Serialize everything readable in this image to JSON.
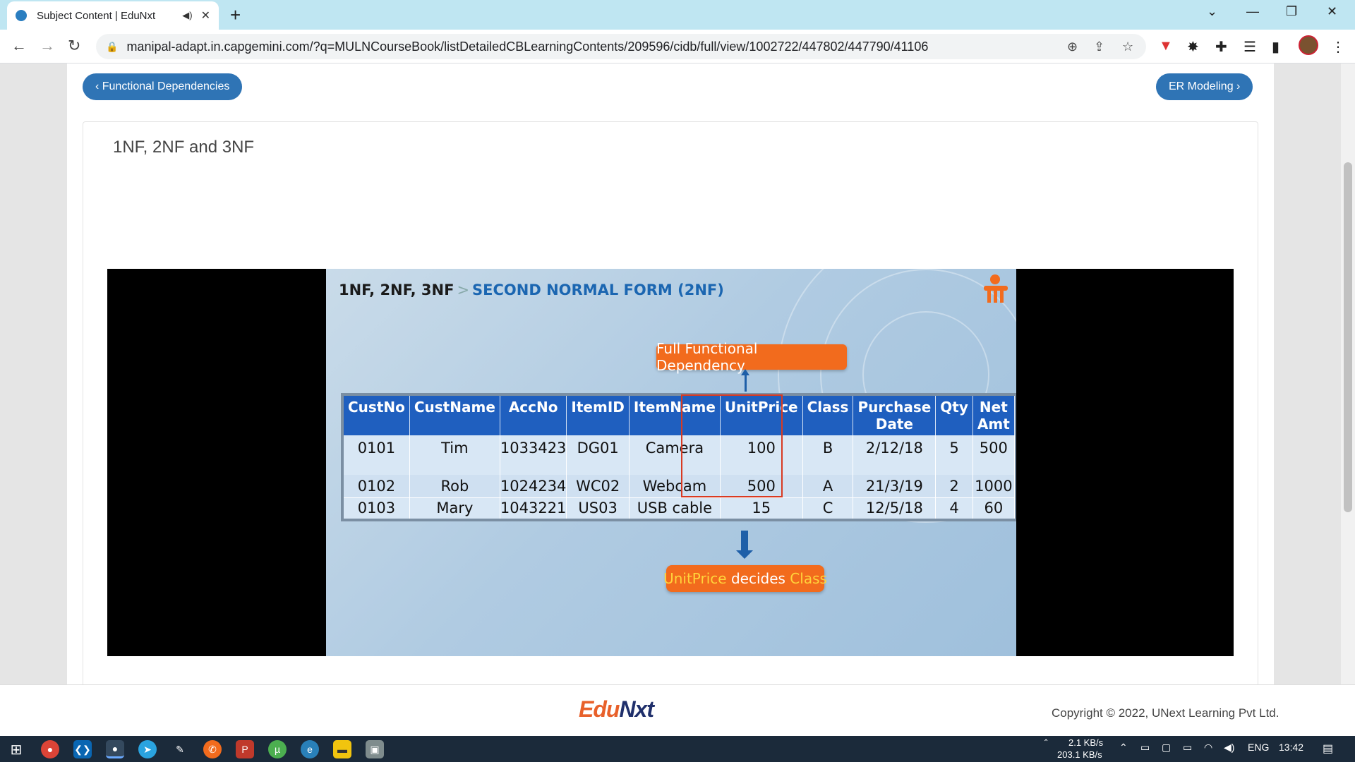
{
  "browser": {
    "tab_title": "Subject Content | EduNxt",
    "tab_audio_icon": "speaker-icon",
    "url": "manipal-adapt.in.capgemini.com/?q=MULNCourseBook/listDetailedCBLearningContents/209596/cidb/full/view/1002722/447802/447790/41106"
  },
  "nav": {
    "prev_label": "‹ Functional Dependencies",
    "next_label": "ER Modeling ›"
  },
  "page": {
    "title": "1NF, 2NF and 3NF"
  },
  "slide": {
    "crumb_parent": "1NF, 2NF, 3NF",
    "crumb_sep": ">",
    "crumb_current": "SECOND NORMAL FORM (2NF)",
    "top_callout": "Full Functional Dependency",
    "bottom_callout_a": "UnitPrice",
    "bottom_callout_b": " decides ",
    "bottom_callout_c": "Class",
    "table": {
      "headers": [
        "CustNo",
        "CustName",
        "AccNo",
        "ItemID",
        "ItemName",
        "UnitPrice",
        "Class",
        "Purchase Date",
        "Qty",
        "Net Amt"
      ],
      "rows": [
        [
          "0101",
          "Tim",
          "1033423",
          "DG01",
          "Camera",
          "100",
          "B",
          "2/12/18",
          "5",
          "500"
        ],
        [
          "0102",
          "Rob",
          "1024234",
          "WC02",
          "Webcam",
          "500",
          "A",
          "21/3/19",
          "2",
          "1000"
        ],
        [
          "0103",
          "Mary",
          "1043221",
          "US03",
          "USB cable",
          "15",
          "C",
          "12/5/18",
          "4",
          "60"
        ]
      ]
    }
  },
  "footer": {
    "brand_a": "Edu",
    "brand_b": "Nxt",
    "copyright": "Copyright © 2022, UNext Learning Pvt Ltd."
  },
  "taskbar": {
    "net_up": "2.1 KB/s",
    "net_down": "203.1 KB/s",
    "lang": "ENG",
    "time": "13:42"
  },
  "colors": {
    "accent": "#2f74b5",
    "orange": "#f26b1d",
    "table_header": "#1f5fbf"
  }
}
